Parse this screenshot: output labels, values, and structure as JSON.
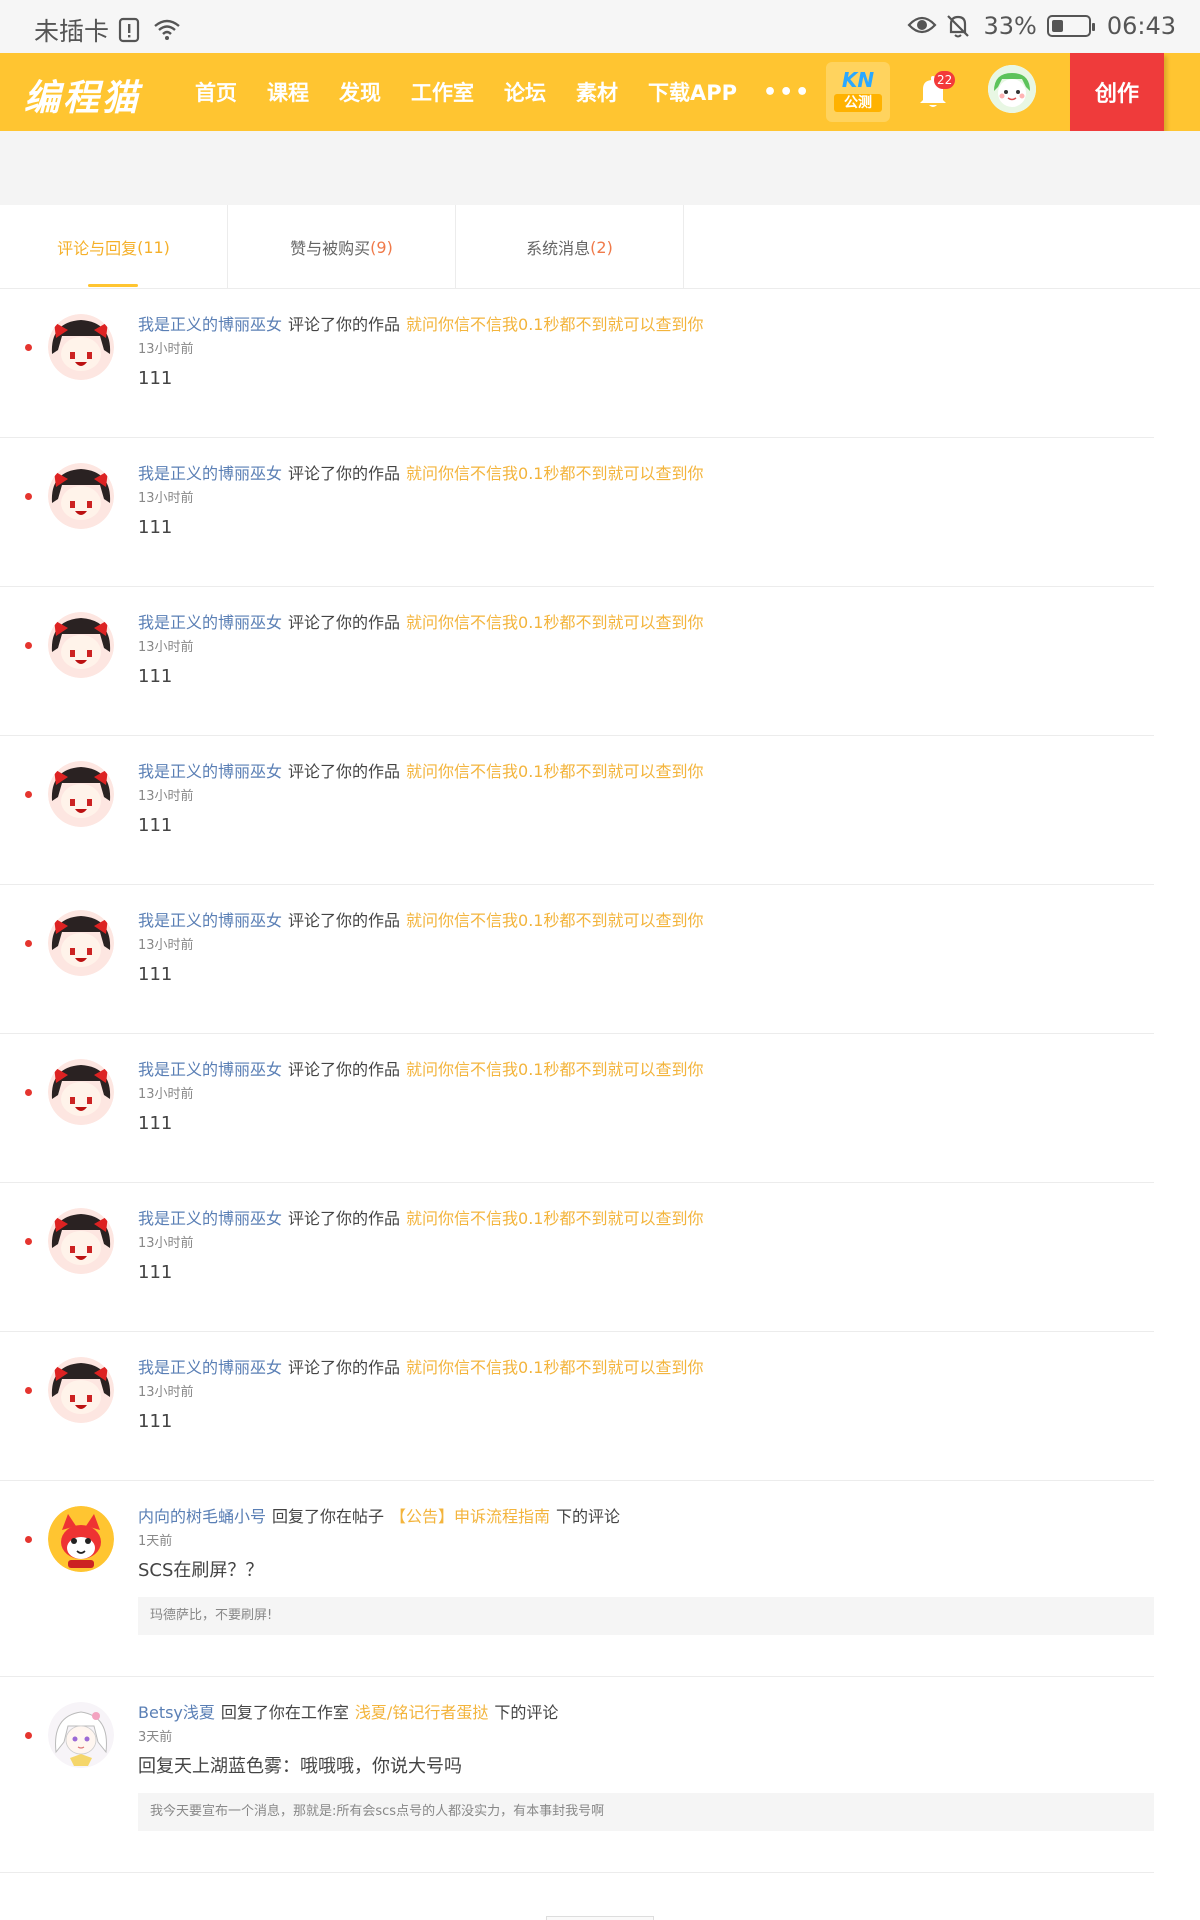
{
  "status_bar": {
    "carrier": "未插卡",
    "battery": "33%",
    "battery_level": 0.33,
    "time": "06:43",
    "icons": [
      "sim-alert-icon",
      "wifi-icon",
      "eye-icon",
      "bell-off-icon",
      "battery-icon"
    ]
  },
  "header": {
    "logo": "编程猫",
    "nav": [
      "首页",
      "课程",
      "发现",
      "工作室",
      "论坛",
      "素材",
      "下载APP"
    ],
    "more": "•••",
    "kn_label": "KN",
    "kn_beta": "公测",
    "notification_count": "22",
    "create_label": "创作",
    "colors": {
      "brand": "#ffc531",
      "create": "#ef3b3b"
    }
  },
  "tabs": [
    {
      "label": "评论与回复",
      "count": "(11)",
      "active": true
    },
    {
      "label": "赞与被购买",
      "count": "(9)",
      "active": false
    },
    {
      "label": "系统消息",
      "count": "(2)",
      "active": false
    }
  ],
  "messages": [
    {
      "user": "我是正义的博丽巫女",
      "action": "评论了你的作品",
      "target": "就问你信不信我0.1秒都不到就可以查到你",
      "suffix": "",
      "time": "13小时前",
      "content": "111",
      "quote": "",
      "avatar": "reimu"
    },
    {
      "user": "我是正义的博丽巫女",
      "action": "评论了你的作品",
      "target": "就问你信不信我0.1秒都不到就可以查到你",
      "suffix": "",
      "time": "13小时前",
      "content": "111",
      "quote": "",
      "avatar": "reimu"
    },
    {
      "user": "我是正义的博丽巫女",
      "action": "评论了你的作品",
      "target": "就问你信不信我0.1秒都不到就可以查到你",
      "suffix": "",
      "time": "13小时前",
      "content": "111",
      "quote": "",
      "avatar": "reimu"
    },
    {
      "user": "我是正义的博丽巫女",
      "action": "评论了你的作品",
      "target": "就问你信不信我0.1秒都不到就可以查到你",
      "suffix": "",
      "time": "13小时前",
      "content": "111",
      "quote": "",
      "avatar": "reimu"
    },
    {
      "user": "我是正义的博丽巫女",
      "action": "评论了你的作品",
      "target": "就问你信不信我0.1秒都不到就可以查到你",
      "suffix": "",
      "time": "13小时前",
      "content": "111",
      "quote": "",
      "avatar": "reimu"
    },
    {
      "user": "我是正义的博丽巫女",
      "action": "评论了你的作品",
      "target": "就问你信不信我0.1秒都不到就可以查到你",
      "suffix": "",
      "time": "13小时前",
      "content": "111",
      "quote": "",
      "avatar": "reimu"
    },
    {
      "user": "我是正义的博丽巫女",
      "action": "评论了你的作品",
      "target": "就问你信不信我0.1秒都不到就可以查到你",
      "suffix": "",
      "time": "13小时前",
      "content": "111",
      "quote": "",
      "avatar": "reimu"
    },
    {
      "user": "我是正义的博丽巫女",
      "action": "评论了你的作品",
      "target": "就问你信不信我0.1秒都不到就可以查到你",
      "suffix": "",
      "time": "13小时前",
      "content": "111",
      "quote": "",
      "avatar": "reimu"
    },
    {
      "user": "内向的树毛蛹小号",
      "action": "回复了你在帖子",
      "target": "【公告】申诉流程指南",
      "suffix": "下的评论",
      "time": "1天前",
      "content": "SCS在刷屏？？",
      "quote": "玛德萨比，不要刷屏!",
      "avatar": "fox"
    },
    {
      "user": "Betsy浅夏",
      "action": "回复了你在工作室",
      "target": "浅夏/铭记行者蛋挞",
      "suffix": "下的评论",
      "time": "3天前",
      "content": "回复天上湖蓝色雾：哦哦哦，你说大号吗",
      "quote": "我今天要宣布一个消息，那就是:所有会scs点号的人都没实力，有本事封我号啊",
      "avatar": "anime"
    }
  ]
}
